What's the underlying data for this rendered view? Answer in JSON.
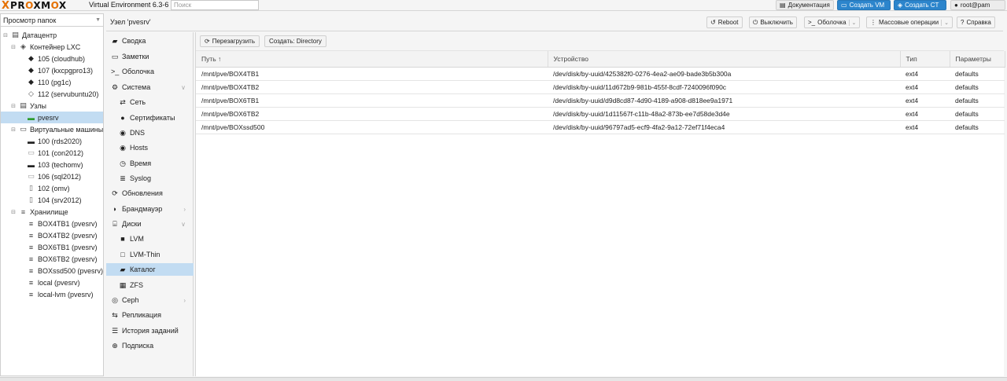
{
  "header": {
    "logo_x": "X",
    "logo_text_a": "PR",
    "logo_text_o1": "O",
    "logo_text_b": "XM",
    "logo_text_o2": "O",
    "logo_text_c": "X",
    "version": "Virtual Environment 6.3-6",
    "search_placeholder": "Поиск",
    "docs": "Документация",
    "create_vm": "Создать VM",
    "create_ct": "Создать CT",
    "user": "root@pam"
  },
  "left": {
    "view_select": "Просмотр папок",
    "tree": [
      {
        "label": "Датацентр",
        "icon": "datacenter"
      },
      {
        "label": "Контейнер LXC",
        "icon": "container-group"
      },
      {
        "label": "105 (cloudhub)",
        "icon": "ct-running"
      },
      {
        "label": "107 (kxcpgpro13)",
        "icon": "ct-running"
      },
      {
        "label": "110 (pg1c)",
        "icon": "ct-running"
      },
      {
        "label": "112 (servubuntu20)",
        "icon": "ct-stopped"
      },
      {
        "label": "Узлы",
        "icon": "nodes"
      },
      {
        "label": "pvesrv",
        "icon": "node-online"
      },
      {
        "label": "Виртуальные машины (",
        "icon": "vm-group"
      },
      {
        "label": "100 (rds2020)",
        "icon": "vm-running"
      },
      {
        "label": "101 (con2012)",
        "icon": "vm-stopped"
      },
      {
        "label": "103 (techomv)",
        "icon": "vm-running"
      },
      {
        "label": "106 (sql2012)",
        "icon": "vm-stopped"
      },
      {
        "label": "102 (omv)",
        "icon": "vm-template"
      },
      {
        "label": "104 (srv2012)",
        "icon": "vm-template"
      },
      {
        "label": "Хранилище",
        "icon": "storage-group"
      },
      {
        "label": "BOX4TB1 (pvesrv)",
        "icon": "storage"
      },
      {
        "label": "BOX4TB2 (pvesrv)",
        "icon": "storage"
      },
      {
        "label": "BOX6TB1 (pvesrv)",
        "icon": "storage"
      },
      {
        "label": "BOX6TB2 (pvesrv)",
        "icon": "storage"
      },
      {
        "label": "BOXssd500 (pvesrv)",
        "icon": "storage"
      },
      {
        "label": "local (pvesrv)",
        "icon": "storage"
      },
      {
        "label": "local-lvm (pvesrv)",
        "icon": "storage"
      }
    ]
  },
  "node_bar": {
    "title": "Узел 'pvesrv'",
    "reboot": "Reboot",
    "shutdown": "Выключить",
    "shell": "Оболочка",
    "bulk": "Массовые операции",
    "help": "Справка"
  },
  "menu": [
    {
      "label": "Сводка",
      "icon": "book-icon"
    },
    {
      "label": "Заметки",
      "icon": "notes-icon"
    },
    {
      "label": "Оболочка",
      "icon": "terminal-icon"
    },
    {
      "label": "Система",
      "icon": "cogs-icon"
    },
    {
      "label": "Сеть",
      "icon": "network-icon"
    },
    {
      "label": "Сертификаты",
      "icon": "certificate-icon"
    },
    {
      "label": "DNS",
      "icon": "globe-icon"
    },
    {
      "label": "Hosts",
      "icon": "globe-icon"
    },
    {
      "label": "Время",
      "icon": "clock-icon"
    },
    {
      "label": "Syslog",
      "icon": "list-icon"
    },
    {
      "label": "Обновления",
      "icon": "refresh-icon"
    },
    {
      "label": "Брандмауэр",
      "icon": "shield-icon"
    },
    {
      "label": "Диски",
      "icon": "hdd-icon"
    },
    {
      "label": "LVM",
      "icon": "square-icon"
    },
    {
      "label": "LVM-Thin",
      "icon": "square-outline-icon"
    },
    {
      "label": "Каталог",
      "icon": "folder-icon"
    },
    {
      "label": "ZFS",
      "icon": "grid-icon"
    },
    {
      "label": "Ceph",
      "icon": "ceph-icon"
    },
    {
      "label": "Репликация",
      "icon": "retweet-icon"
    },
    {
      "label": "История заданий",
      "icon": "list-alt-icon"
    },
    {
      "label": "Подписка",
      "icon": "support-icon"
    }
  ],
  "content": {
    "reload": "Перезагрузить",
    "create_dir": "Создать: Directory",
    "columns": [
      "Путь ↑",
      "Устройство",
      "Тип",
      "Параметры"
    ],
    "rows": [
      [
        "/mnt/pve/BOX4TB1",
        "/dev/disk/by-uuid/425382f0-0276-4ea2-ae09-bade3b5b300a",
        "ext4",
        "defaults"
      ],
      [
        "/mnt/pve/BOX4TB2",
        "/dev/disk/by-uuid/11d672b9-981b-455f-8cdf-7240096f090c",
        "ext4",
        "defaults"
      ],
      [
        "/mnt/pve/BOX6TB1",
        "/dev/disk/by-uuid/d9d8cd87-4d90-4189-a908-d818ee9a1971",
        "ext4",
        "defaults"
      ],
      [
        "/mnt/pve/BOX6TB2",
        "/dev/disk/by-uuid/1d11567f-c11b-48a2-873b-ee7d58de3d4e",
        "ext4",
        "defaults"
      ],
      [
        "/mnt/pve/BOXssd500",
        "/dev/disk/by-uuid/96797ad5-ecf9-4fa2-9a12-72ef71f4eca4",
        "ext4",
        "defaults"
      ]
    ]
  },
  "colors": {
    "accent": "#2c85cc",
    "selection": "#c2dcf2",
    "brand_orange": "#e57000"
  }
}
